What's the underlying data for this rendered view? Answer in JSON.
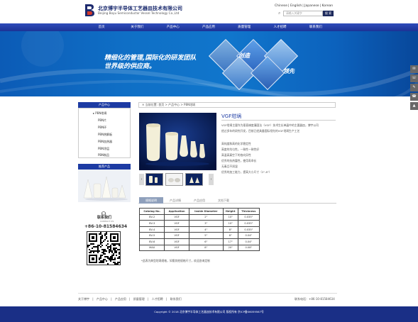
{
  "header": {
    "company_cn": "北京博宇半导体工艺器皿技术有限公司",
    "company_en": "Beijing Boyu Semiconductor Vessel Technology Co.,Ltd",
    "logo_caption": "B O Y U",
    "languages": [
      "Chinese",
      "English",
      "Japanese",
      "Korean"
    ],
    "search_placeholder": "请输入关键字",
    "search_button": "搜 索"
  },
  "nav": {
    "items": [
      "首页",
      "关于我们",
      "产品中心",
      "产品应用",
      "质量管理",
      "人才招聘",
      "联系我们"
    ]
  },
  "banner": {
    "line1": "精细化的管理,国际化的研发团队",
    "line2": "世界级的供应商。",
    "word1": "创造",
    "word2": "领先"
  },
  "side_tools": [
    "✉",
    "☏",
    "✎",
    "☎",
    "▲"
  ],
  "sidebar": {
    "category_title": "产品中心",
    "categories": [
      "PBN坩埚",
      "PBN片",
      "PBN环",
      "PBN热解板",
      "PBN加热器",
      "PBN涂层",
      "PBN制品"
    ],
    "recommend_title": "推荐产品",
    "contact_title": "联系我们",
    "contact_sub": "CONTACT US",
    "contact_phone": "+86-10-81584634"
  },
  "breadcrumb": "✕ 当前位置: 首页 > 产品中心 > PBN坩埚",
  "product": {
    "title": "VGF坩埚",
    "desc": [
      "VGF坩埚主要作为垂直梯度凝固法（VGF）技术生长单晶中的主要器皿，博宇公司",
      "经过多年的研究开发，目前已经具备国际领先的VGF坩埚生产工艺",
      "",
      "高纯度和高的化学稳定性",
      "高度的均匀性，一致性一致性好",
      "高温高真空下的各向异性",
      "优秀的抗热震性，使用寿命长",
      "无毒且不润湿",
      "优秀的加工能力，提高大小尺寸（2\"-8\"）"
    ]
  },
  "tabs": [
    "规格说明",
    "产品详情",
    "产品应用",
    "文档下载"
  ],
  "spec_table": {
    "headers": [
      "Catalog No.",
      "Application",
      "Inside Diameter",
      "Height",
      "Thickness"
    ],
    "rows": [
      [
        "BV-2",
        "VGF",
        "2\"",
        "10\"",
        "0.035\""
      ],
      [
        "BV-3",
        "VGF",
        "3\"",
        "10\"",
        "0.035\""
      ],
      [
        "BV-4",
        "VGF",
        "4\"",
        "8\"",
        "0.035\""
      ],
      [
        "BV-5",
        "VGF",
        "5\"",
        "8\"",
        "0.04\""
      ],
      [
        "BV-6",
        "VGF",
        "6\"",
        "17\"",
        "0.04\""
      ],
      [
        "MAX",
        "VGF",
        "8\"",
        "20\"",
        "0.08\""
      ]
    ]
  },
  "note": "*此表为典型坩埚规格，如需其他规格尺寸，欢迎咨询定制",
  "footer": {
    "links": [
      "关于博宇",
      "|",
      "产品中心",
      "|",
      "产品应用",
      "|",
      "质量管理",
      "|",
      "人才招聘",
      "|",
      "联系我们"
    ],
    "phone": "联系电话：+86-10-81584634",
    "copyright": "Copyright © 2018 北京博宇半导体工艺器皿技术有限公司 版权所有 京ICP备06059567号"
  },
  "colors": {
    "nav": "#1b3295",
    "banner": "#0f6fc6",
    "footer": "#1a2f86",
    "accent": "#1d3ba3"
  }
}
